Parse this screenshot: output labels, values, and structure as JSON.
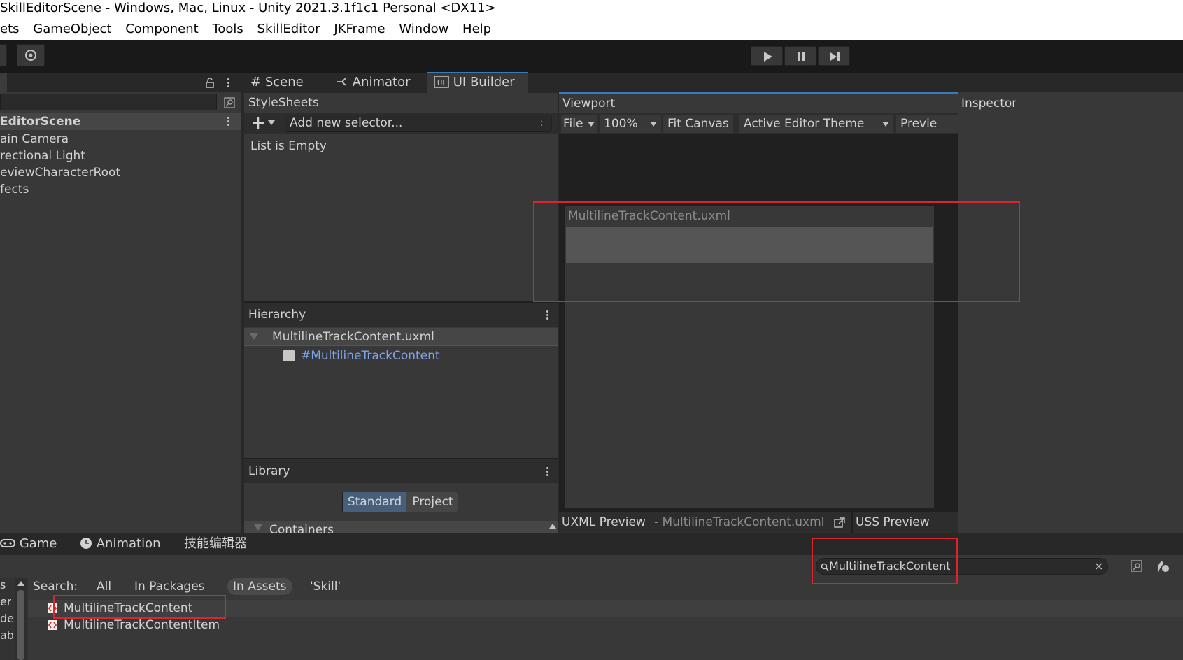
{
  "window": {
    "title": "SkillEditorScene - Windows, Mac, Linux - Unity 2021.3.1f1c1 Personal <DX11>"
  },
  "menu": [
    "ets",
    "GameObject",
    "Component",
    "Tools",
    "SkillEditor",
    "JKFrame",
    "Window",
    "Help"
  ],
  "hierarchy_panel": {
    "scene": "EditorScene",
    "items": [
      "ain Camera",
      "rectional Light",
      "eviewCharacterRoot",
      "fects"
    ]
  },
  "center_tabs": [
    {
      "label": "Scene",
      "icon": "grid-icon"
    },
    {
      "label": "Animator",
      "icon": "animator-icon"
    },
    {
      "label": "UI Builder",
      "icon": "ui-builder-icon"
    }
  ],
  "stylesheets": {
    "title": "StyleSheets",
    "selector_placeholder": "Add new selector...",
    "selector_shortcut": ":",
    "empty_text": "List is Empty"
  },
  "builder_hierarchy": {
    "title": "Hierarchy",
    "root": "MultilineTrackContent.uxml",
    "child": "#MultilineTrackContent"
  },
  "library": {
    "title": "Library",
    "tabs": [
      "Standard",
      "Project"
    ],
    "active_tab": "Standard",
    "section": "Containers"
  },
  "viewport": {
    "title": "Viewport",
    "file_menu": "File",
    "zoom": "100%",
    "fit_canvas": "Fit Canvas",
    "theme": "Active Editor Theme",
    "preview": "Previe",
    "canvas_title": "MultilineTrackContent.uxml",
    "uxml_preview_label": "UXML Preview",
    "uxml_preview_file": "- MultilineTrackContent.uxml",
    "uss_preview_label": "USS Preview"
  },
  "inspector": {
    "title": "Inspector"
  },
  "bottom_tabs": [
    {
      "label": "Game",
      "icon": "gamepad-icon"
    },
    {
      "label": "Animation",
      "icon": "clock-icon"
    },
    {
      "label": "技能编辑器",
      "icon": ""
    }
  ],
  "project": {
    "search_value": "MultilineTrackContent",
    "search_label": "Search:",
    "scopes": [
      "All",
      "In Packages",
      "In Assets",
      "'Skill'"
    ],
    "active_scope": "In Assets",
    "results": [
      "MultilineTrackContent",
      "MultilineTrackContentItem"
    ],
    "left_fragments": [
      "s",
      "er",
      "del",
      "ab"
    ]
  },
  "colors": {
    "highlight_box": "#e0232b",
    "accent_blue": "#7ea3e8",
    "active_tab_blue": "#3a79bb"
  }
}
